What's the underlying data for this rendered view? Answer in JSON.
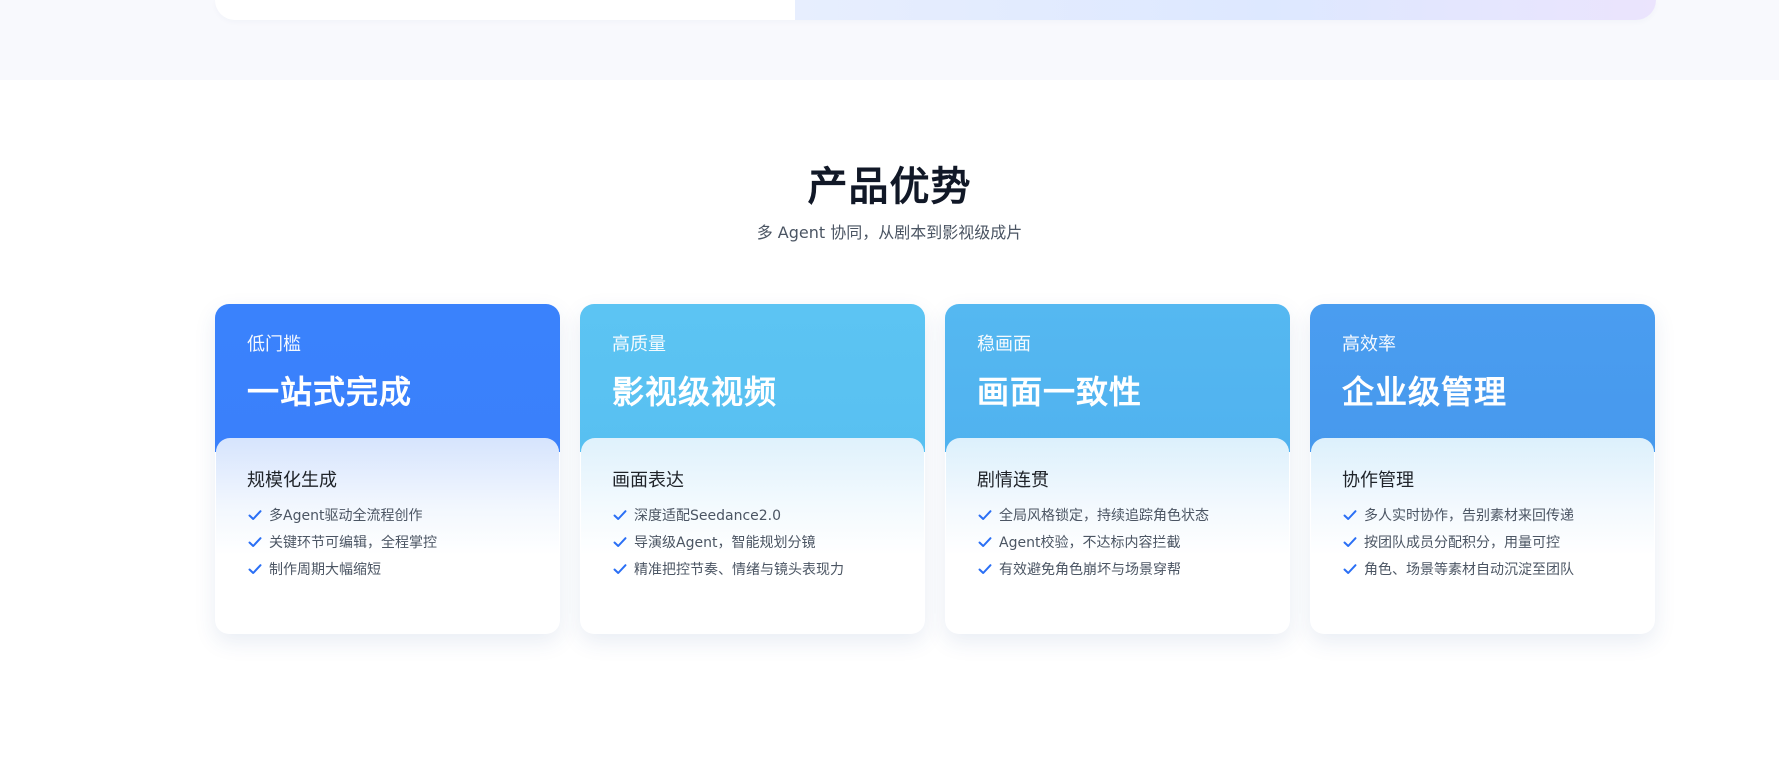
{
  "section": {
    "title": "产品优势",
    "subtitle": "多 Agent 协同，从剧本到影视级成片"
  },
  "colors": {
    "accent_check": "#2a6ff5",
    "card1_head": "#3a82fc",
    "card2_head": "#5cc4f3",
    "card3_head": "#55b8f1",
    "card4_head": "#4a9df0"
  },
  "icons": {
    "feature_bullet": "check-icon"
  },
  "cards": [
    {
      "label": "低门槛",
      "headline": "一站式完成",
      "body_title": "规模化生成",
      "features": [
        "多Agent驱动全流程创作",
        "关键环节可编辑，全程掌控",
        "制作周期大幅缩短"
      ]
    },
    {
      "label": "高质量",
      "headline": "影视级视频",
      "body_title": "画面表达",
      "features": [
        "深度适配Seedance2.0",
        "导演级Agent，智能规划分镜",
        "精准把控节奏、情绪与镜头表现力"
      ]
    },
    {
      "label": "稳画面",
      "headline": "画面一致性",
      "body_title": "剧情连贯",
      "features": [
        "全局风格锁定，持续追踪角色状态",
        "Agent校验，不达标内容拦截",
        "有效避免角色崩坏与场景穿帮"
      ]
    },
    {
      "label": "高效率",
      "headline": "企业级管理",
      "body_title": "协作管理",
      "features": [
        "多人实时协作，告别素材来回传递",
        "按团队成员分配积分，用量可控",
        "角色、场景等素材自动沉淀至团队"
      ]
    }
  ]
}
